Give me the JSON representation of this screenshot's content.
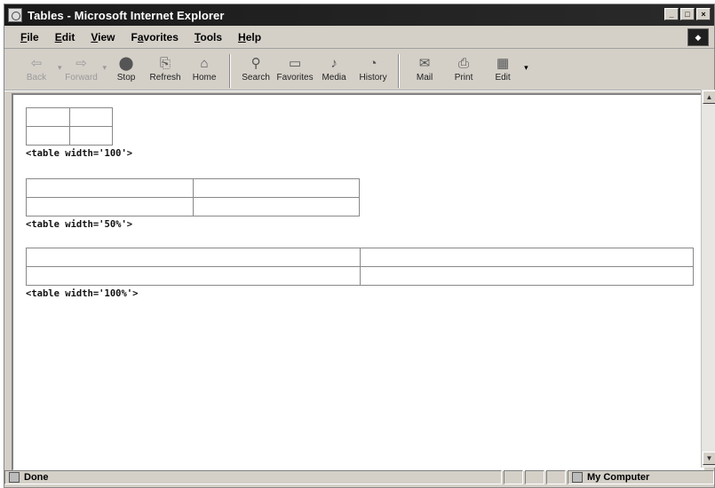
{
  "window": {
    "title": "Tables - Microsoft Internet Explorer"
  },
  "title_buttons": {
    "minimize": "_",
    "maximize": "□",
    "close": "×"
  },
  "menu": [
    {
      "label": "File",
      "key": "F",
      "rest": "ile"
    },
    {
      "label": "Edit",
      "key": "E",
      "rest": "dit"
    },
    {
      "label": "View",
      "key": "V",
      "rest": "iew"
    },
    {
      "label": "Favorites",
      "key": "a",
      "pre": "F",
      "rest": "vorites"
    },
    {
      "label": "Tools",
      "key": "T",
      "rest": "ools"
    },
    {
      "label": "Help",
      "key": "H",
      "rest": "elp"
    }
  ],
  "toolbar": {
    "back": "Back",
    "forward": "Forward",
    "stop": "Stop",
    "refresh": "Refresh",
    "home": "Home",
    "search": "Search",
    "favorites": "Favorites",
    "media": "Media",
    "history": "History",
    "mail": "Mail",
    "print": "Print",
    "edit": "Edit"
  },
  "icons": {
    "back": "back-arrow-icon",
    "forward": "forward-arrow-icon",
    "stop": "stop-icon",
    "refresh": "refresh-icon",
    "home": "home-icon",
    "search": "search-icon",
    "favorites": "favorites-icon",
    "media": "media-icon",
    "history": "history-icon",
    "mail": "mail-icon",
    "print": "print-icon",
    "edit": "edit-icon"
  },
  "content": {
    "caption1": "<table width='100'>",
    "caption2": "<table width='50%'>",
    "caption3": "<table width='100%'>"
  },
  "status": {
    "text": "Done",
    "zone": "My Computer"
  }
}
